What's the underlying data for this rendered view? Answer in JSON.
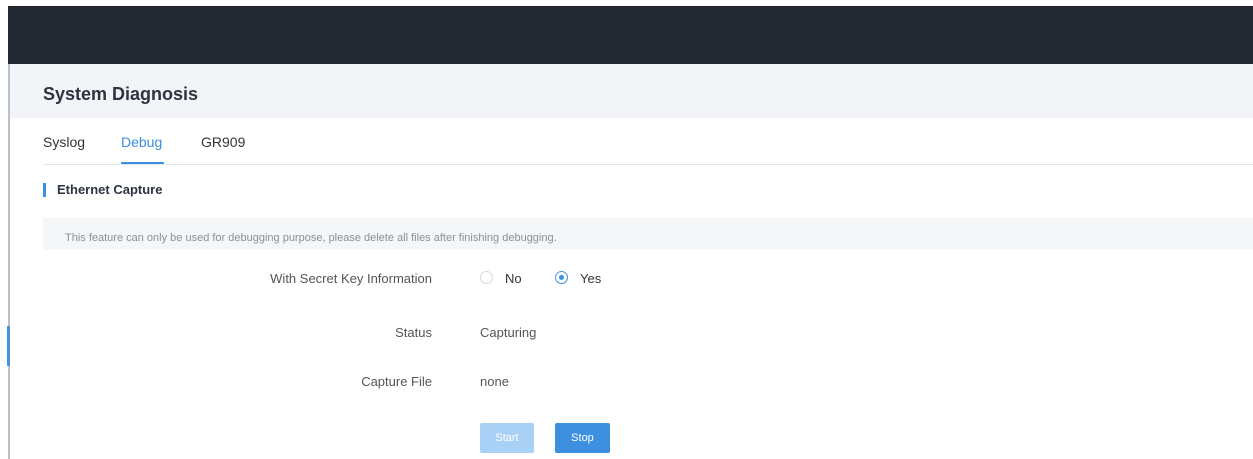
{
  "page": {
    "title": "System Diagnosis"
  },
  "tabs": [
    {
      "label": "Syslog"
    },
    {
      "label": "Debug"
    },
    {
      "label": "GR909"
    }
  ],
  "active_tab": "Debug",
  "section": {
    "title": "Ethernet Capture"
  },
  "notice": "This feature can only be used for debugging purpose, please delete all files after finishing debugging.",
  "form": {
    "secret_key": {
      "label": "With Secret Key Information",
      "options": [
        "No",
        "Yes"
      ],
      "selected": "Yes"
    },
    "status": {
      "label": "Status",
      "value": "Capturing"
    },
    "capture_file": {
      "label": "Capture File",
      "value": "none"
    }
  },
  "buttons": {
    "start": "Start",
    "stop": "Stop"
  },
  "colors": {
    "accent": "#3d8fe0",
    "topbar": "#232832",
    "disabled_button": "#a9d1f6"
  }
}
